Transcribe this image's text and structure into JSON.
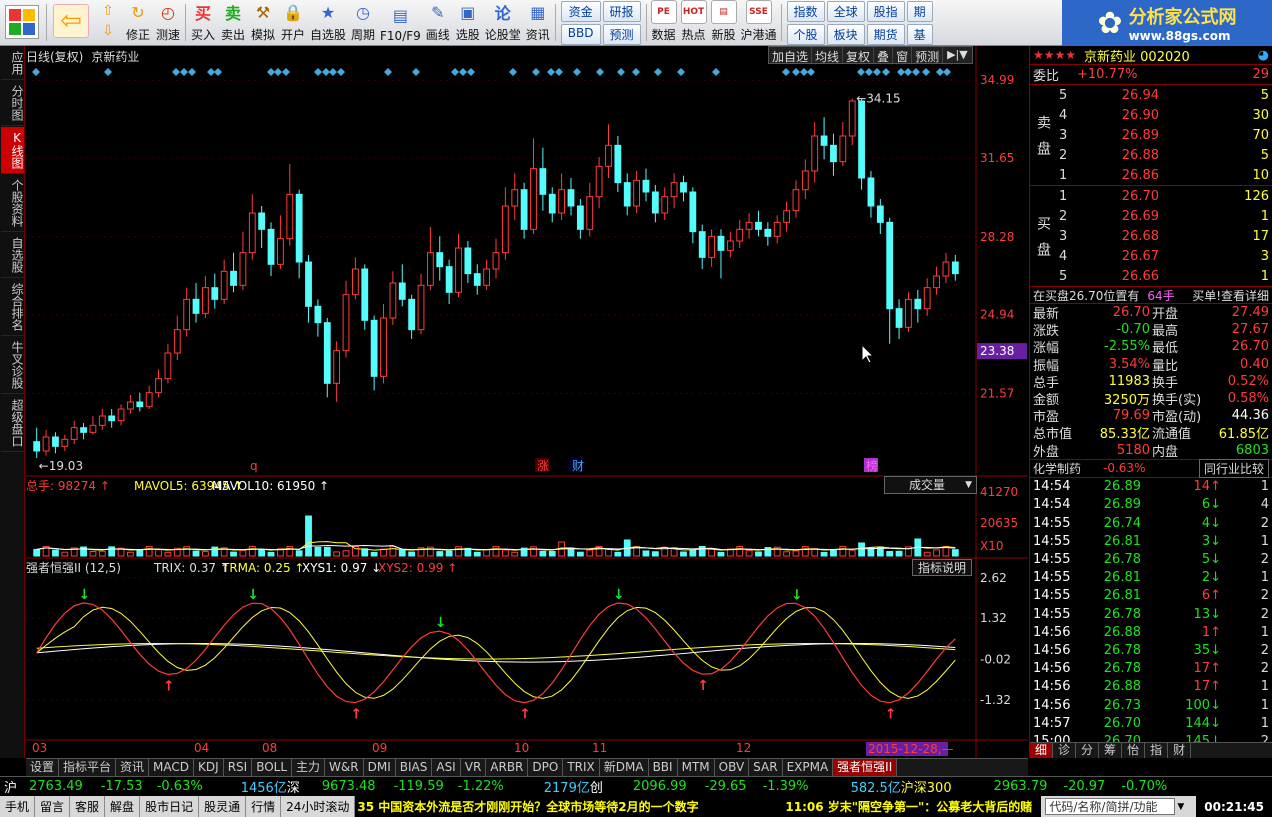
{
  "toolbar": {
    "buttons": [
      {
        "id": "buy",
        "label": "买入",
        "icon": "buy-icon",
        "glyph": "买",
        "color": "#e33"
      },
      {
        "id": "sell",
        "label": "卖出",
        "icon": "sell-icon",
        "glyph": "卖",
        "color": "#2a2"
      },
      {
        "id": "simulate",
        "label": "模拟",
        "icon": "hammer-icon",
        "glyph": "⚒",
        "color": "#a60"
      },
      {
        "id": "open",
        "label": "开户",
        "icon": "lock-icon",
        "glyph": "🔒",
        "color": "#777"
      },
      {
        "id": "watchlist",
        "label": "自选股",
        "icon": "star-icon",
        "glyph": "★",
        "color": "#36c"
      },
      {
        "id": "period",
        "label": "周期",
        "icon": "clock-icon",
        "glyph": "◷",
        "color": "#36c"
      },
      {
        "id": "f10",
        "label": "F10/F9",
        "icon": "f10-icon",
        "glyph": "▤",
        "color": "#36c"
      },
      {
        "id": "draw",
        "label": "画线",
        "icon": "pen-icon",
        "glyph": "✎",
        "color": "#36c"
      },
      {
        "id": "pick",
        "label": "选股",
        "icon": "screen-icon",
        "glyph": "▣",
        "color": "#36c"
      },
      {
        "id": "forum",
        "label": "论股堂",
        "icon": "forum-icon",
        "glyph": "论",
        "color": "#36c"
      },
      {
        "id": "info",
        "label": "资讯",
        "icon": "news-icon",
        "glyph": "▦",
        "color": "#36c"
      }
    ],
    "nav_left": {
      "back_icon": "back-arrow-icon",
      "fix": "修正",
      "test": "测速"
    },
    "small_group1": [
      "资金",
      "研报",
      "BBD",
      "预测"
    ],
    "right_buttons": [
      {
        "id": "data",
        "label": "数据",
        "icon": "pe-icon",
        "glyph": "PE"
      },
      {
        "id": "hot",
        "label": "热点",
        "icon": "hot-icon",
        "glyph": "HOT"
      },
      {
        "id": "ipo",
        "label": "新股",
        "icon": "doc-icon",
        "glyph": "▤"
      },
      {
        "id": "hk",
        "label": "沪港通",
        "icon": "hk-icon",
        "glyph": "SSE"
      }
    ],
    "small_group2": [
      "指数",
      "全球",
      "股指",
      "期",
      "个股",
      "板块",
      "期货",
      "基"
    ]
  },
  "logo": {
    "title": "分析家公式网",
    "url": "www.88gs.com"
  },
  "leftbar": [
    "应用",
    "分时图",
    "K线图",
    "个股资料",
    "自选股",
    "综合排名",
    "牛叉诊股",
    "超级盘口"
  ],
  "leftbar_active": 2,
  "chart_header": {
    "period": "日线(复权)",
    "name": "京新药业",
    "buttons": [
      "加自选",
      "均线",
      "复权",
      "叠",
      "窗",
      "预测"
    ]
  },
  "chart_data": {
    "type": "candlestick",
    "price_axis": [
      "34.99",
      "31.65",
      "28.28",
      "24.94",
      "21.57"
    ],
    "current_price_tag": "23.38",
    "high_label": "34.15",
    "low_label": "19.03",
    "x_labels": [
      "03",
      "04",
      "08",
      "09",
      "10",
      "11",
      "12"
    ],
    "event_markers": [
      "q",
      "涨",
      "财",
      "榜"
    ],
    "candles": [
      [
        19.5,
        19.1,
        20.1,
        18.8
      ],
      [
        19.1,
        19.7,
        20.0,
        18.9
      ],
      [
        19.7,
        19.3,
        19.9,
        19.0
      ],
      [
        19.3,
        19.6,
        19.8,
        19.1
      ],
      [
        19.6,
        20.1,
        20.4,
        19.4
      ],
      [
        20.1,
        19.9,
        20.3,
        19.6
      ],
      [
        19.9,
        20.2,
        20.6,
        19.8
      ],
      [
        20.2,
        20.6,
        20.9,
        20.0
      ],
      [
        20.6,
        20.4,
        20.9,
        20.1
      ],
      [
        20.4,
        20.9,
        21.1,
        20.2
      ],
      [
        20.9,
        21.2,
        21.5,
        20.7
      ],
      [
        21.2,
        21.0,
        21.6,
        20.8
      ],
      [
        21.0,
        21.6,
        21.9,
        20.9
      ],
      [
        21.6,
        22.2,
        22.6,
        21.4
      ],
      [
        22.2,
        23.3,
        23.7,
        22.0
      ],
      [
        23.3,
        24.3,
        24.9,
        23.0
      ],
      [
        24.3,
        25.6,
        26.1,
        24.0
      ],
      [
        25.6,
        25.0,
        26.3,
        24.6
      ],
      [
        25.0,
        26.1,
        26.6,
        24.8
      ],
      [
        26.1,
        25.6,
        26.7,
        25.2
      ],
      [
        25.6,
        26.8,
        27.3,
        25.4
      ],
      [
        26.8,
        26.2,
        27.6,
        25.9
      ],
      [
        26.2,
        27.6,
        28.5,
        26.0
      ],
      [
        27.6,
        29.3,
        30.1,
        27.3
      ],
      [
        29.3,
        28.6,
        29.6,
        27.8
      ],
      [
        28.6,
        27.1,
        28.9,
        26.6
      ],
      [
        27.1,
        28.2,
        29.2,
        26.9
      ],
      [
        28.2,
        30.1,
        31.4,
        27.9
      ],
      [
        30.1,
        27.2,
        30.3,
        26.5
      ],
      [
        27.2,
        25.3,
        27.5,
        24.6
      ],
      [
        25.3,
        24.6,
        25.6,
        24.0
      ],
      [
        24.6,
        22.0,
        24.8,
        21.4
      ],
      [
        22.0,
        23.4,
        23.8,
        21.2
      ],
      [
        23.4,
        25.8,
        26.4,
        23.1
      ],
      [
        25.8,
        26.9,
        27.4,
        25.6
      ],
      [
        26.9,
        24.7,
        27.1,
        24.3
      ],
      [
        24.7,
        22.3,
        24.9,
        21.7
      ],
      [
        22.3,
        24.8,
        25.4,
        22.0
      ],
      [
        24.8,
        26.3,
        26.8,
        24.5
      ],
      [
        26.3,
        25.6,
        27.1,
        25.3
      ],
      [
        25.6,
        24.3,
        25.8,
        23.9
      ],
      [
        24.3,
        26.2,
        26.7,
        24.1
      ],
      [
        26.2,
        27.6,
        28.7,
        26.0
      ],
      [
        27.6,
        27.0,
        28.3,
        26.4
      ],
      [
        27.0,
        25.9,
        27.3,
        25.4
      ],
      [
        25.9,
        27.8,
        28.4,
        25.7
      ],
      [
        27.8,
        26.7,
        28.1,
        26.3
      ],
      [
        26.7,
        26.2,
        27.1,
        25.8
      ],
      [
        26.2,
        26.9,
        27.3,
        26.0
      ],
      [
        26.9,
        27.6,
        28.2,
        26.5
      ],
      [
        27.6,
        29.6,
        30.4,
        27.3
      ],
      [
        29.6,
        30.3,
        31.0,
        29.0
      ],
      [
        30.3,
        28.6,
        30.6,
        28.2
      ],
      [
        28.6,
        31.2,
        32.5,
        28.4
      ],
      [
        31.2,
        30.1,
        32.1,
        29.4
      ],
      [
        30.1,
        29.3,
        30.4,
        28.9
      ],
      [
        29.3,
        30.3,
        31.0,
        29.0
      ],
      [
        30.3,
        29.6,
        30.8,
        29.2
      ],
      [
        29.6,
        28.6,
        29.9,
        28.2
      ],
      [
        28.6,
        30.0,
        30.6,
        28.3
      ],
      [
        30.0,
        31.3,
        31.7,
        29.5
      ],
      [
        31.3,
        32.2,
        33.1,
        30.8
      ],
      [
        32.2,
        30.6,
        32.6,
        30.2
      ],
      [
        30.6,
        29.6,
        31.0,
        29.2
      ],
      [
        29.6,
        30.7,
        31.1,
        29.3
      ],
      [
        30.7,
        30.2,
        31.2,
        29.8
      ],
      [
        30.2,
        29.3,
        30.5,
        28.9
      ],
      [
        29.3,
        30.0,
        30.4,
        29.0
      ],
      [
        30.0,
        30.6,
        31.0,
        29.5
      ],
      [
        30.6,
        30.2,
        30.9,
        29.8
      ],
      [
        30.2,
        28.5,
        30.4,
        28.0
      ],
      [
        28.5,
        27.4,
        28.8,
        26.9
      ],
      [
        27.4,
        28.3,
        28.6,
        27.0
      ],
      [
        28.3,
        27.7,
        28.6,
        26.5
      ],
      [
        27.7,
        28.1,
        28.5,
        27.4
      ],
      [
        28.1,
        28.6,
        29.0,
        27.8
      ],
      [
        28.6,
        28.9,
        29.3,
        28.2
      ],
      [
        28.9,
        28.6,
        29.4,
        28.3
      ],
      [
        28.6,
        28.3,
        28.9,
        27.9
      ],
      [
        28.3,
        28.9,
        29.2,
        28.0
      ],
      [
        28.9,
        29.4,
        29.8,
        28.5
      ],
      [
        29.4,
        30.3,
        30.7,
        29.1
      ],
      [
        30.3,
        31.1,
        31.6,
        29.9
      ],
      [
        31.1,
        32.6,
        33.2,
        30.6
      ],
      [
        32.6,
        32.2,
        33.4,
        31.6
      ],
      [
        32.2,
        31.5,
        32.7,
        30.9
      ],
      [
        31.5,
        32.6,
        33.2,
        31.3
      ],
      [
        32.6,
        34.1,
        34.2,
        32.2
      ],
      [
        34.1,
        30.8,
        34.2,
        30.3
      ],
      [
        30.8,
        29.6,
        31.1,
        29.1
      ],
      [
        29.6,
        28.9,
        29.9,
        28.4
      ],
      [
        28.9,
        25.2,
        29.1,
        23.7
      ],
      [
        25.2,
        24.4,
        25.6,
        23.9
      ],
      [
        24.4,
        25.6,
        25.9,
        24.2
      ],
      [
        25.6,
        25.2,
        26.0,
        24.6
      ],
      [
        25.2,
        26.1,
        26.5,
        24.9
      ],
      [
        26.1,
        26.6,
        27.0,
        25.8
      ],
      [
        26.6,
        27.2,
        27.6,
        26.3
      ],
      [
        27.2,
        26.7,
        27.5,
        26.4
      ]
    ],
    "volume": {
      "label": "总手: 98274",
      "mavol5": "MAVOL5: 63945",
      "mavol10": "MAVOL10: 61950",
      "axis": [
        "41270",
        "20635",
        "X10"
      ],
      "selector": "成交量"
    },
    "indicator": {
      "name": "强者恒强II (12,5)",
      "trix": "TRIX: 0.37",
      "trma": "TRMA: 0.25",
      "xys1": "XYS1: 0.97",
      "xys2": "XYS2: 0.99",
      "axis": [
        "2.62",
        "1.32",
        "-0.02",
        "-1.32"
      ],
      "help": "指标说明",
      "date_tag": "2015-12-28,—"
    }
  },
  "bottom_tabs": [
    "设置",
    "指标平台",
    "资讯",
    "MACD",
    "KDJ",
    "RSI",
    "BOLL",
    "主力",
    "W&R",
    "DMI",
    "BIAS",
    "ASI",
    "VR",
    "ARBR",
    "DPO",
    "TRIX",
    "新DMA",
    "BBI",
    "MTM",
    "OBV",
    "SAR",
    "EXPMA",
    "强者恒强II"
  ],
  "bottom_tab_active": 22,
  "quote": {
    "stock_title": "京新药业 002020",
    "weibi_label": "委比",
    "weibi": "+10.77%",
    "weicha": "29",
    "sell_label": [
      "卖",
      "盘"
    ],
    "buy_label": [
      "买",
      "盘"
    ],
    "sell": [
      [
        "5",
        "26.94",
        "5"
      ],
      [
        "4",
        "26.90",
        "30"
      ],
      [
        "3",
        "26.89",
        "70"
      ],
      [
        "2",
        "26.88",
        "5"
      ],
      [
        "1",
        "26.86",
        "10"
      ]
    ],
    "buy": [
      [
        "1",
        "26.70",
        "126"
      ],
      [
        "2",
        "26.69",
        "1"
      ],
      [
        "3",
        "26.68",
        "17"
      ],
      [
        "4",
        "26.67",
        "3"
      ],
      [
        "5",
        "26.66",
        "1"
      ]
    ],
    "notice": "在买盘26.70位置有",
    "notice_vol": "64手",
    "notice_tail": "买单!查看详细",
    "stats": [
      [
        "最新",
        "26.70",
        "开盘",
        "27.49"
      ],
      [
        "涨跌",
        "-0.70",
        "最高",
        "27.67"
      ],
      [
        "涨幅",
        "-2.55%",
        "最低",
        "26.70"
      ],
      [
        "振幅",
        "3.54%",
        "量比",
        "0.40"
      ],
      [
        "总手",
        "11983",
        "换手",
        "0.52%"
      ],
      [
        "金额",
        "3250万",
        "换手(实)",
        "0.58%"
      ],
      [
        "市盈",
        "79.69",
        "市盈(动)",
        "44.36"
      ],
      [
        "总市值",
        "85.33亿",
        "流通值",
        "61.85亿"
      ],
      [
        "外盘",
        "5180",
        "内盘",
        "6803"
      ]
    ],
    "sector": "化学制药",
    "sector_chg": "-0.63%",
    "sector_cmp": "同行业比较",
    "ticks": [
      [
        "14:54",
        "26.89",
        "14",
        "1"
      ],
      [
        "14:54",
        "26.89",
        "6",
        "4"
      ],
      [
        "14:55",
        "26.74",
        "4",
        "2"
      ],
      [
        "14:55",
        "26.81",
        "3",
        "1"
      ],
      [
        "14:55",
        "26.78",
        "5",
        "2"
      ],
      [
        "14:55",
        "26.81",
        "2",
        "1"
      ],
      [
        "14:55",
        "26.81",
        "6",
        "2"
      ],
      [
        "14:55",
        "26.78",
        "13",
        "2"
      ],
      [
        "14:56",
        "26.88",
        "1",
        "1"
      ],
      [
        "14:56",
        "26.78",
        "35",
        "2"
      ],
      [
        "14:56",
        "26.78",
        "17",
        "2"
      ],
      [
        "14:56",
        "26.88",
        "17",
        "1"
      ],
      [
        "14:56",
        "26.73",
        "100",
        "1"
      ],
      [
        "14:57",
        "26.70",
        "144",
        "1"
      ],
      [
        "15:00",
        "26.70",
        "145",
        "2"
      ]
    ],
    "tick_dirs": [
      "up",
      "dn",
      "dn",
      "dn",
      "dn",
      "dn",
      "up",
      "dn",
      "up",
      "dn",
      "up",
      "up",
      "dn",
      "dn",
      "dn"
    ],
    "tabs": [
      "细",
      "诊",
      "分",
      "筹",
      "怡",
      "指",
      "财"
    ]
  },
  "status1": {
    "sh_label": "沪",
    "sh": "2763.49",
    "sh_chg": "-17.53",
    "sh_pct": "-0.63%",
    "sh_amt": "1456亿",
    "sz_label": "深",
    "sz": "9673.48",
    "sz_chg": "-119.59",
    "sz_pct": "-1.22%",
    "sz_amt": "2179亿",
    "cy_label": "创",
    "cy": "2096.99",
    "cy_chg": "-29.65",
    "cy_pct": "-1.39%",
    "hs_amt": "582.5亿",
    "hs_label": "沪深300",
    "hs": "2963.79",
    "hs_chg": "-20.97",
    "hs_pct": "-0.70%"
  },
  "status2": {
    "items": [
      "手机",
      "留言",
      "客服",
      "解盘",
      "股市日记",
      "股灵通",
      "行情",
      "24小时滚动"
    ],
    "news1": "35 中国资本外流是否才刚刚开始？全球市场等待2月的一个数字",
    "news2": "11:06 岁末\"隔空争第一\"：公募老大背后的赌",
    "search": "代码/名称/简拼/功能",
    "time": "00:21:45"
  }
}
